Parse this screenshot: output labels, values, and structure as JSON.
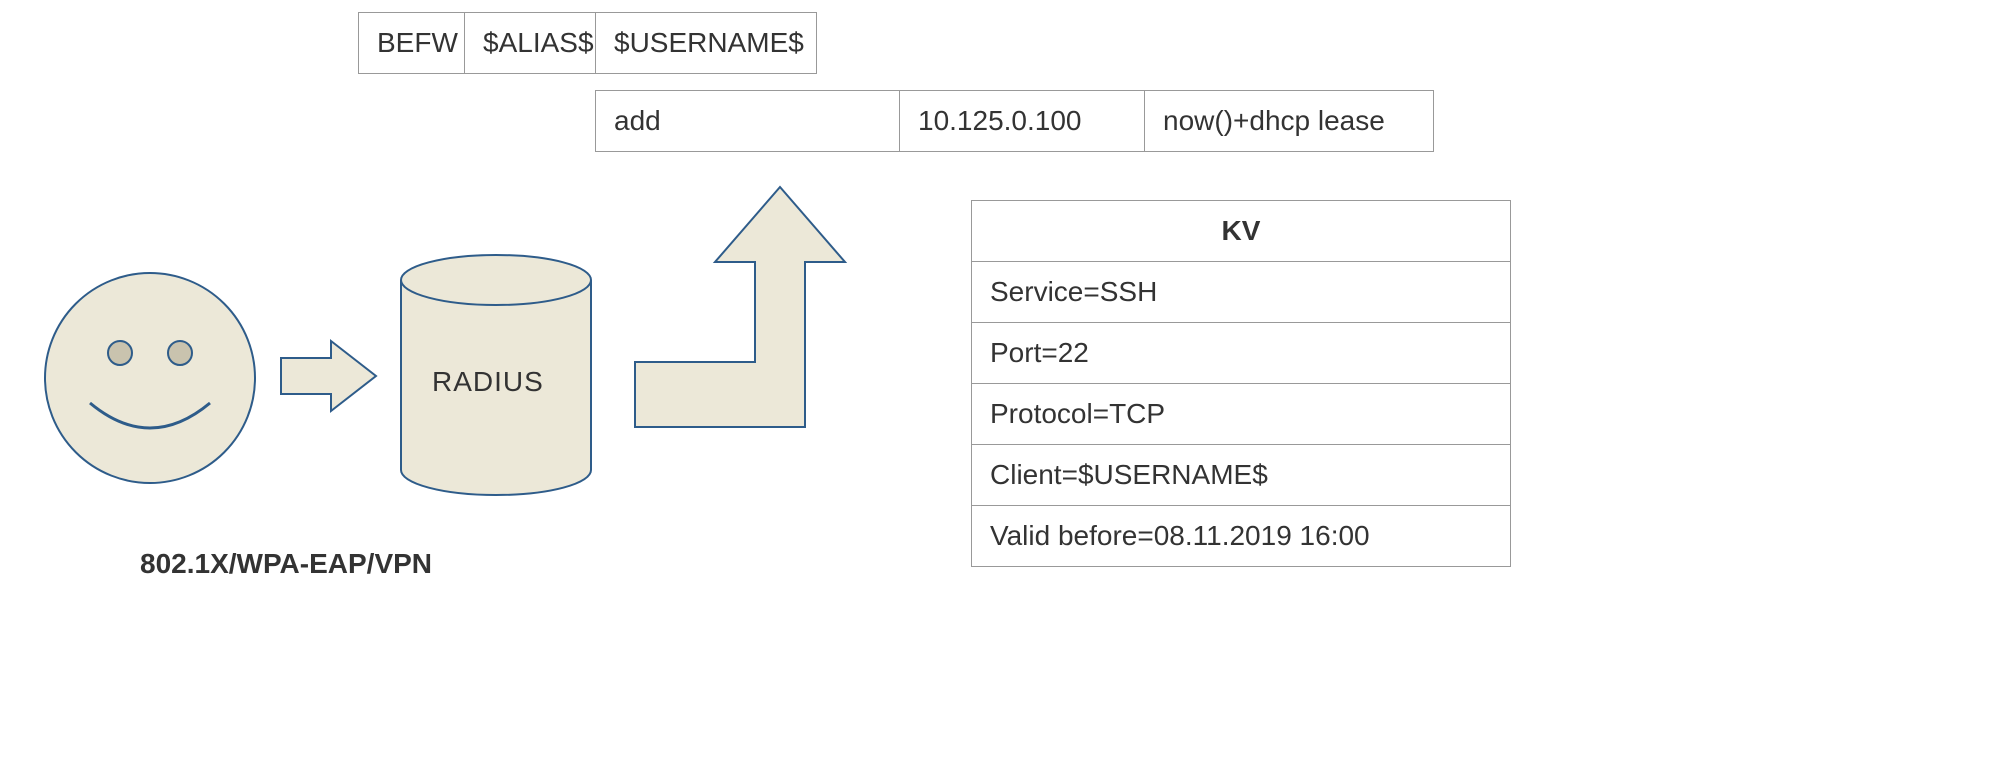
{
  "topRow": {
    "c1": "BEFW",
    "c2": "$ALIAS$",
    "c3": "$USERNAME$"
  },
  "secondRow": {
    "c1": "add",
    "c2": "10.125.0.100",
    "c3": "now()+dhcp lease"
  },
  "kv": {
    "title": "KV",
    "rows": [
      "Service=SSH",
      "Port=22",
      "Protocol=TCP",
      "Client=$USERNAME$",
      "Valid before=08.11.2019 16:00"
    ]
  },
  "radius": "RADIUS",
  "caption": "802.1X/WPA-EAP/VPN"
}
